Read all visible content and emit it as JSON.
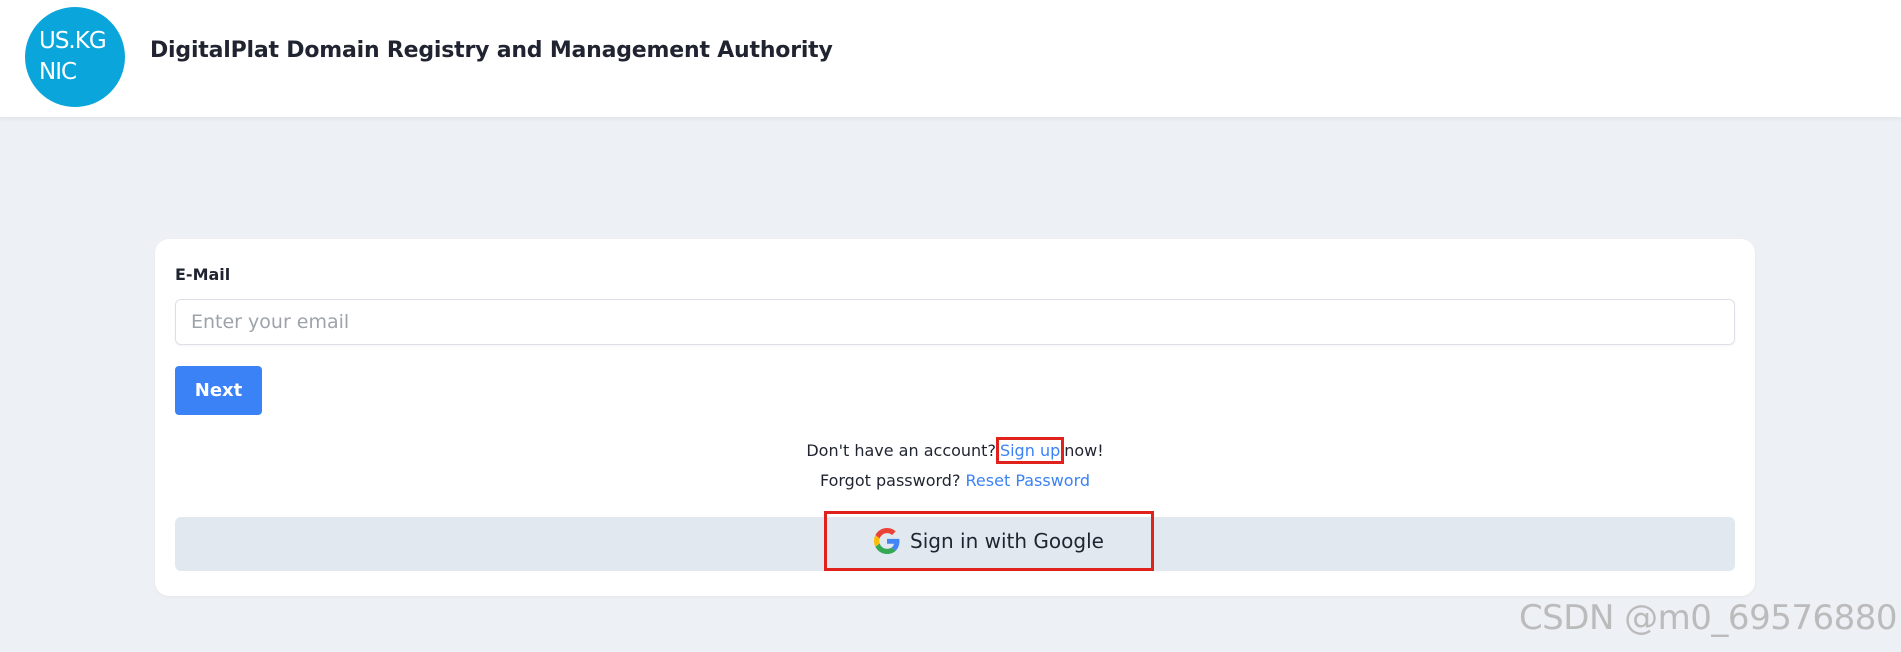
{
  "header": {
    "logo_line1": "US.KG",
    "logo_line2": "NIC",
    "title": "DigitalPlat Domain Registry and Management Authority"
  },
  "login": {
    "email_label": "E-Mail",
    "email_placeholder": "Enter your email",
    "email_value": "",
    "next_label": "Next",
    "signup_prefix": "Don't have an account?",
    "signup_link": "Sign up",
    "signup_suffix": "now!",
    "forgot_prefix": "Forgot password?",
    "reset_link": "Reset Password",
    "google_label": "Sign in with Google"
  },
  "colors": {
    "accent": "#3b82f6",
    "logo": "#0aa6db",
    "highlight": "#e0221c",
    "background": "#edf0f4"
  },
  "icons": {
    "google": "google-g-icon"
  },
  "watermark": "CSDN @m0_69576880"
}
